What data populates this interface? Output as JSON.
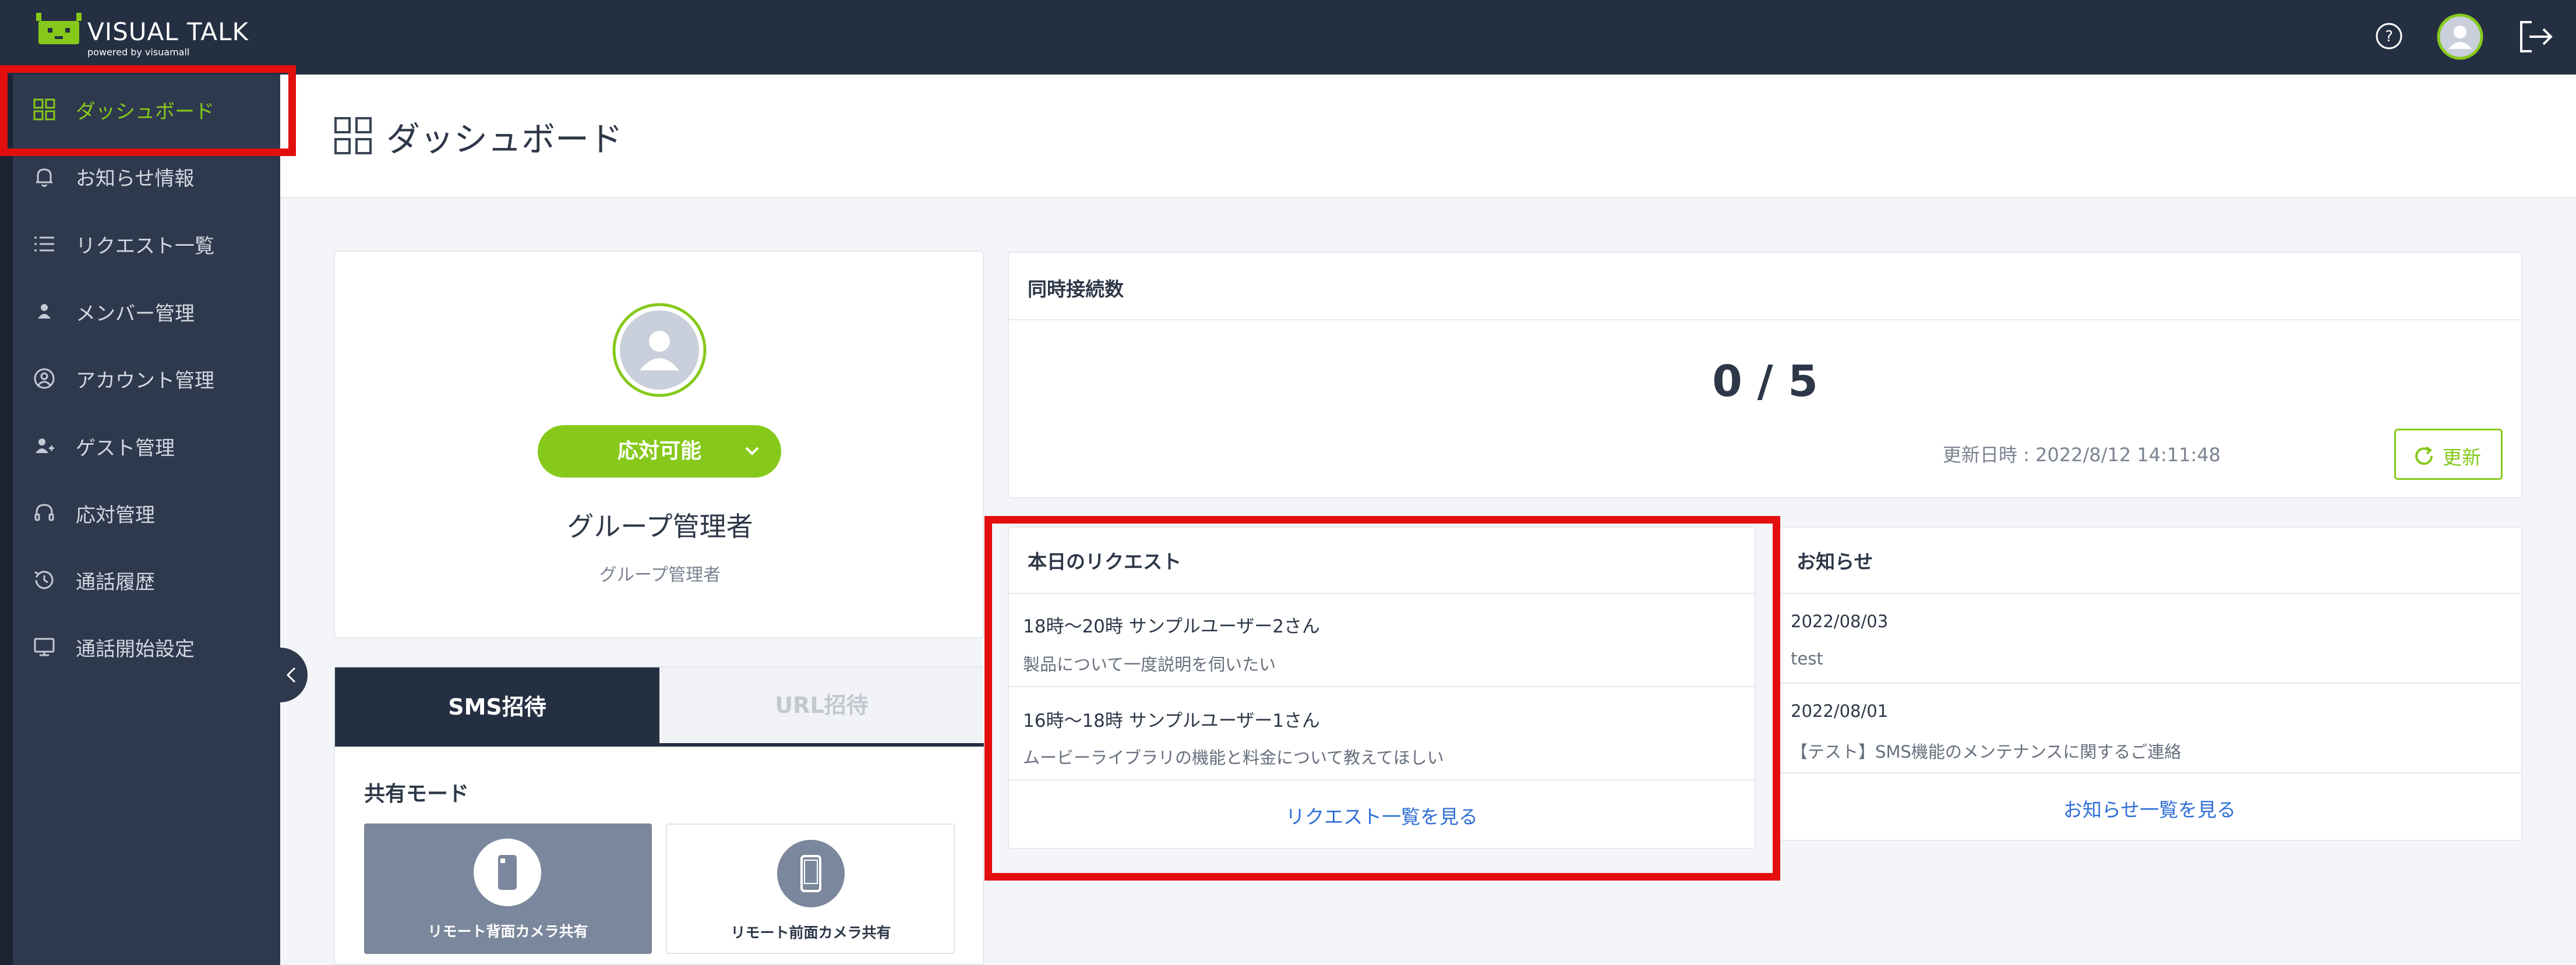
{
  "app": {
    "logo_title": "VISUAL TALK",
    "logo_sub": "powered by visuamall"
  },
  "header_icons": [
    "help-icon",
    "avatar",
    "logout-icon"
  ],
  "sidebar": {
    "items": [
      {
        "label": "ダッシュボード",
        "icon": "grid-icon",
        "active": true
      },
      {
        "label": "お知らせ情報",
        "icon": "bell-icon"
      },
      {
        "label": "リクエスト一覧",
        "icon": "list-icon"
      },
      {
        "label": "メンバー管理",
        "icon": "person-icon"
      },
      {
        "label": "アカウント管理",
        "icon": "account-circle-icon"
      },
      {
        "label": "ゲスト管理",
        "icon": "guest-icon"
      },
      {
        "label": "応対管理",
        "icon": "headset-icon"
      },
      {
        "label": "通話履歴",
        "icon": "history-icon"
      },
      {
        "label": "通話開始設定",
        "icon": "monitor-icon"
      }
    ]
  },
  "page": {
    "title": "ダッシュボード"
  },
  "profile": {
    "status_label": "応対可能",
    "name": "グループ管理者",
    "role": "グループ管理者"
  },
  "invite": {
    "tabs": [
      "SMS招待",
      "URL招待"
    ],
    "active_tab": 0,
    "share_mode_label": "共有モード",
    "modes": [
      {
        "label": "リモート背面カメラ共有",
        "selected": true
      },
      {
        "label": "リモート前面カメラ共有",
        "selected": false
      }
    ]
  },
  "connections": {
    "title": "同時接続数",
    "value": "0 / 5",
    "updated_text": "更新日時 : 2022/8/12 14:11:48",
    "refresh_label": "更新"
  },
  "requests": {
    "title": "本日のリクエスト",
    "items": [
      {
        "line1": "18時〜20時 サンプルユーザー2さん",
        "line2": "製品について一度説明を伺いたい"
      },
      {
        "line1": "16時〜18時 サンプルユーザー1さん",
        "line2": "ムービーライブラリの機能と料金について教えてほしい"
      }
    ],
    "link": "リクエスト一覧を見る"
  },
  "news": {
    "title": "お知らせ",
    "items": [
      {
        "date": "2022/08/03",
        "text": "test"
      },
      {
        "date": "2022/08/01",
        "text": "【テスト】SMS機能のメンテナンスに関するご連絡"
      }
    ],
    "link": "お知らせ一覧を見る"
  },
  "colors": {
    "accent_green": "#86c91b",
    "topbar": "#252f42",
    "sidebar": "#2e394e",
    "link_blue": "#2f6fd6",
    "highlight_red": "#e30f0f"
  }
}
